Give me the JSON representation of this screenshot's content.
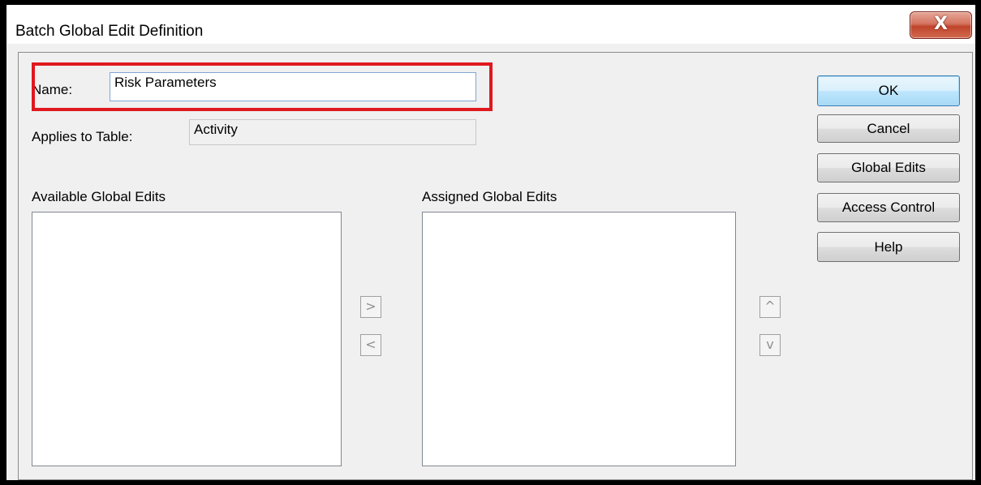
{
  "window": {
    "title": "Batch Global Edit Definition",
    "close_glyph": "X"
  },
  "form": {
    "name_label": "Name:",
    "name_value": "Risk Parameters",
    "applies_label": "Applies to Table:",
    "applies_value": "Activity"
  },
  "lists": {
    "available_label": "Available Global Edits",
    "available_items": [],
    "assigned_label": "Assigned Global Edits",
    "assigned_items": []
  },
  "arrows": {
    "move_right": ">",
    "move_left": "<",
    "move_up": "^",
    "move_down": "v"
  },
  "buttons": {
    "ok": "OK",
    "cancel": "Cancel",
    "global_edits": "Global Edits",
    "access_control": "Access Control",
    "help": "Help"
  },
  "colors": {
    "highlight": "#e0181f",
    "close_button": "#c0442c",
    "default_button_border": "#3c7fb1"
  }
}
